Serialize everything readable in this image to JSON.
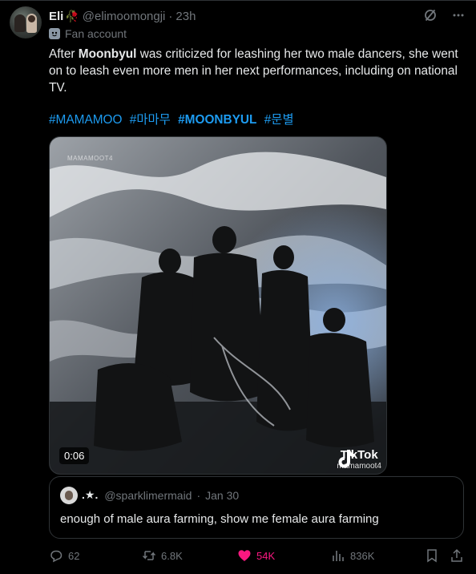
{
  "post": {
    "author_name": "Eli",
    "author_emoji": "🥀",
    "handle": "@elimoomongji",
    "time_sep": "·",
    "time": "23h",
    "label": "Fan account",
    "text_before": "After ",
    "text_bold": "Moonbyul",
    "text_after": " was criticized for leashing her two male dancers, she went on to leash even more men in her next performances, including on national TV.",
    "hashtags": [
      "#MAMAMOO",
      "#마마무",
      "#MOONBYUL",
      "#문별"
    ],
    "more_icon": "more-dots",
    "grok_icon": "grok-slash"
  },
  "video": {
    "duration": "0:06",
    "watermark_brand": "TikTok",
    "watermark_handle": "mamamoot4",
    "corner_watermark": "MAMAMOOT4"
  },
  "quote": {
    "name": ".★.",
    "handle": "@sparklimermaid",
    "time_sep": "·",
    "date": "Jan 30",
    "text": "enough of male aura farming, show me female aura farming"
  },
  "actions": {
    "replies": "62",
    "reposts": "6.8K",
    "likes": "54K",
    "views": "836K"
  },
  "colors": {
    "background": "#000000",
    "text": "#e7e9ea",
    "muted": "#71767b",
    "link": "#1d9bf0",
    "like": "#f91880",
    "border": "#2f3336"
  }
}
